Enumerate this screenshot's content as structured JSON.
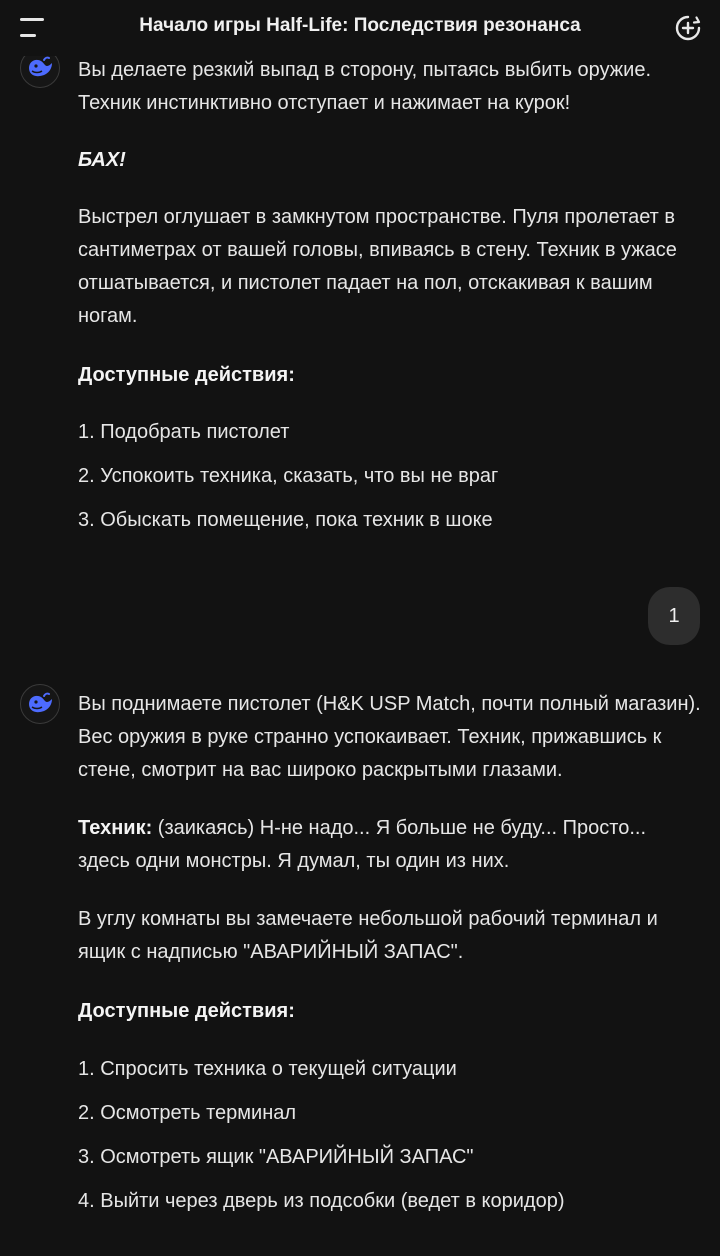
{
  "header": {
    "title": "Начало игры Half-Life: Последствия резонанса"
  },
  "icons": {
    "menu": "menu-icon",
    "new_chat": "new-chat-icon",
    "assistant": "whale-logo-icon",
    "accent": "#4d6bfe"
  },
  "messages": {
    "assistant1": {
      "p1": "Вы делаете резкий выпад в сторону, пытаясь выбить оружие. Техник инстинктивно отступает и нажимает на курок!",
      "p2": "БАХ!",
      "p3": "Выстрел оглушает в замкнутом пространстве. Пуля пролетает в сантиметрах от вашей головы, впиваясь в стену. Техник в ужасе отшатывается, и пистолет падает на пол, отскакивая к вашим ногам.",
      "actions_heading": "Доступные действия:",
      "actions": [
        "1. Подобрать пистолет",
        "2. Успокоить техника, сказать, что вы не враг",
        "3. Обыскать помещение, пока техник в шоке"
      ]
    },
    "user1": {
      "text": "1"
    },
    "assistant2": {
      "p1": "Вы поднимаете пистолет (H&K USP Match, почти полный магазин). Вес оружия в руке странно успокаивает. Техник, прижавшись к стене, смотрит на вас широко раскрытыми глазами.",
      "speaker": "Техник:",
      "speech": " (заикаясь) Н-не надо... Я больше не буду... Просто... здесь одни монстры. Я думал, ты один из них.",
      "p3": "В углу комнаты вы замечаете небольшой рабочий терминал и ящик с надписью \"АВАРИЙНЫЙ ЗАПАС\".",
      "actions_heading": "Доступные действия:",
      "actions": [
        "1. Спросить техника о текущей ситуации",
        "2. Осмотреть терминал",
        "3. Осмотреть ящик \"АВАРИЙНЫЙ ЗАПАС\"",
        "4. Выйти через дверь из подсобки (ведет в коридор)"
      ]
    }
  }
}
